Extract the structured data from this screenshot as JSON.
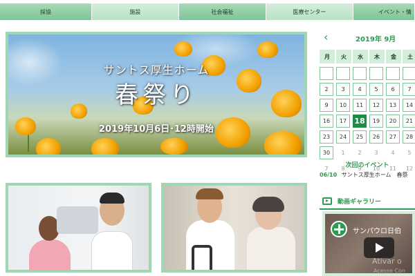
{
  "nav": {
    "items": [
      "採協",
      "施設",
      "社会福祉",
      "医療センター",
      "イベント・情"
    ]
  },
  "banner": {
    "subtitle": "サントス厚生ホーム",
    "title": "春祭り",
    "date": "2019年10月6日･12時開始"
  },
  "calendar": {
    "prev_icon": "chevron-left-icon",
    "title": "2019年  9月",
    "dow": [
      "月",
      "火",
      "水",
      "木",
      "金",
      "土"
    ],
    "weeks": [
      [
        "",
        "",
        "",
        "",
        "",
        ""
      ],
      [
        "2",
        "3",
        "4",
        "5",
        "6",
        "7"
      ],
      [
        "9",
        "10",
        "11",
        "12",
        "13",
        "14"
      ],
      [
        "16",
        "17",
        "18",
        "19",
        "20",
        "21"
      ],
      [
        "23",
        "24",
        "25",
        "26",
        "27",
        "28"
      ],
      [
        "30",
        "1",
        "2",
        "3",
        "4",
        "5"
      ],
      [
        "7",
        "8",
        "9",
        "10",
        "11",
        "12"
      ]
    ],
    "today": "18"
  },
  "next_event": {
    "label": "次回のイベント",
    "date": "06/10",
    "text": "サントス厚生ホーム　春祭"
  },
  "video": {
    "icon": "video-icon",
    "label": "動画ギャラリー",
    "title": "サンパウロ日伯",
    "overlay": "Ativar o",
    "overlay2": "Acesse Con"
  },
  "colors": {
    "accent": "#2f9a51",
    "light": "#d3eedb"
  }
}
